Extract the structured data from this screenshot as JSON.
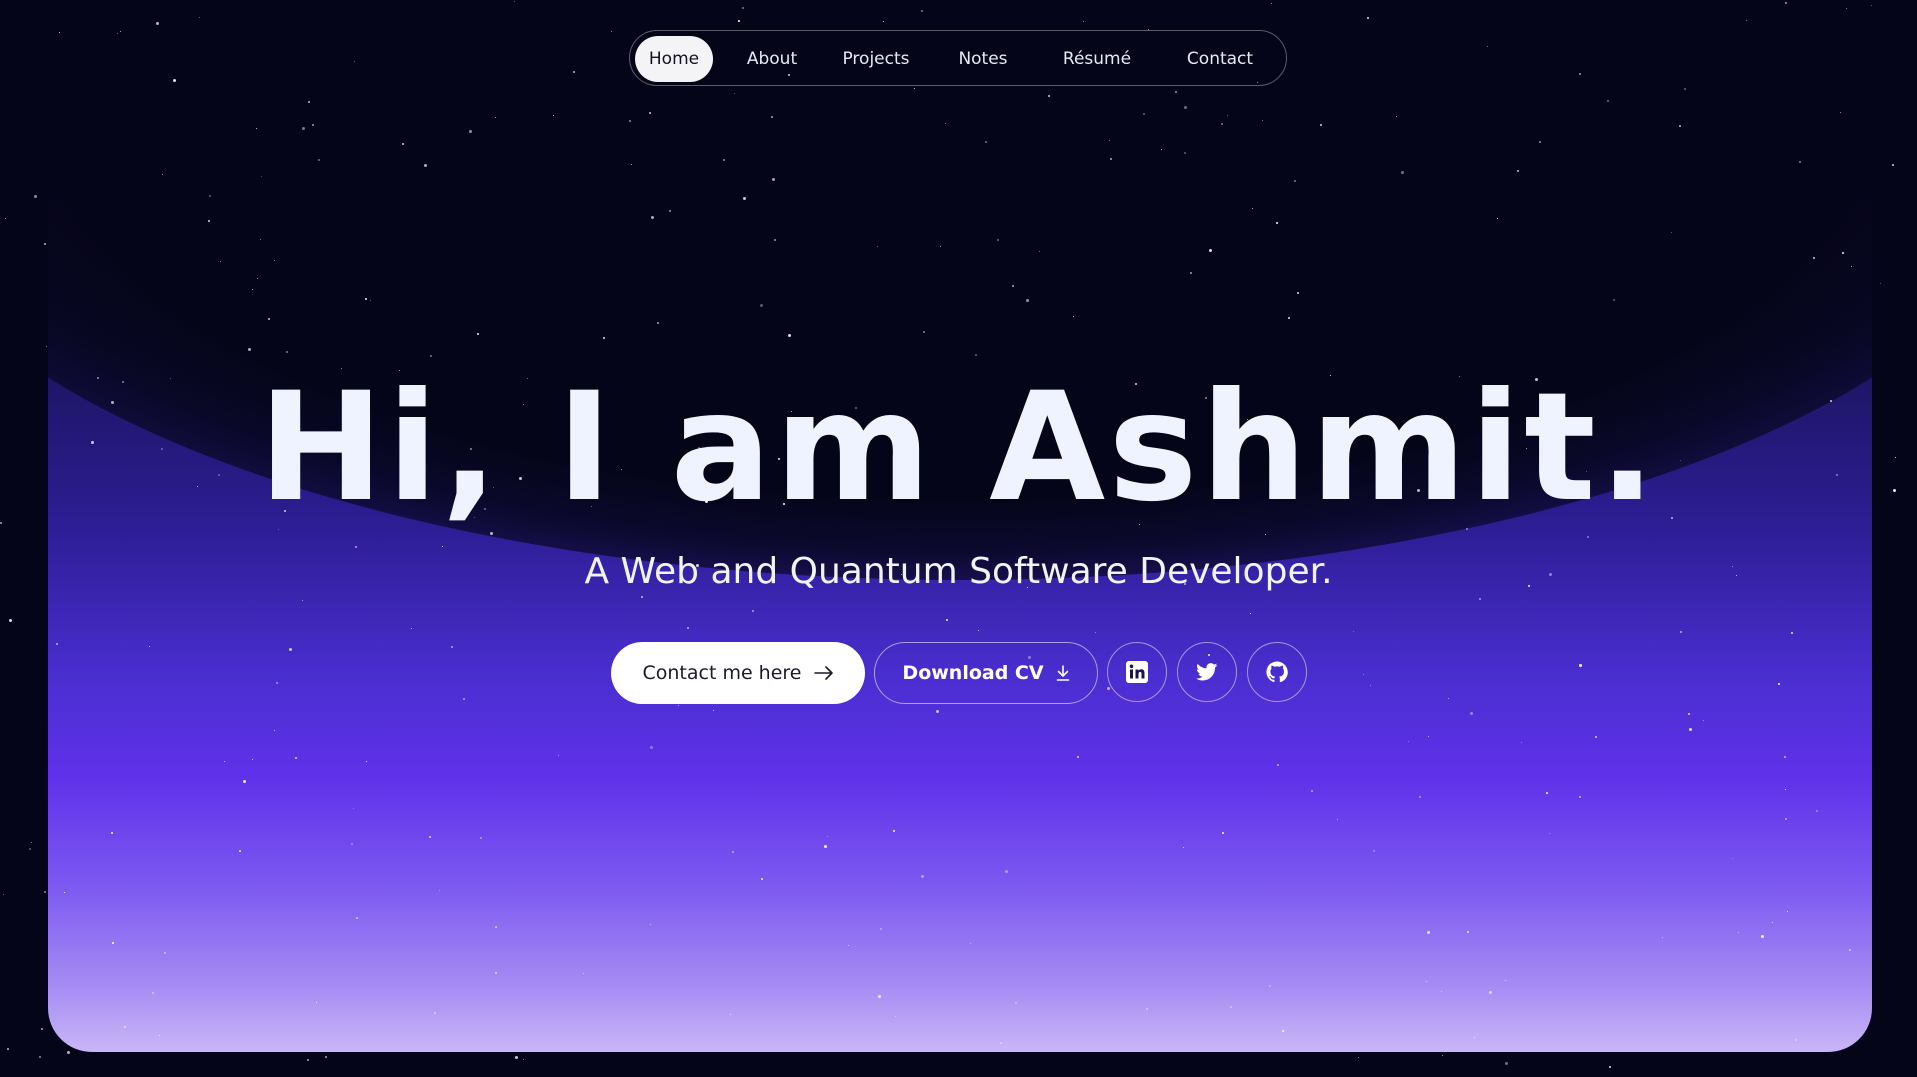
{
  "nav": {
    "items": [
      {
        "label": "Home",
        "active": true
      },
      {
        "label": "About",
        "active": false
      },
      {
        "label": "Projects",
        "active": false
      },
      {
        "label": "Notes",
        "active": false
      },
      {
        "label": "Résumé",
        "active": false
      },
      {
        "label": "Contact",
        "active": false
      }
    ]
  },
  "hero": {
    "title": "Hi, I am Ashmit.",
    "subtitle": "A Web and Quantum Software Developer."
  },
  "actions": {
    "contact_label": "Contact me here",
    "contact_icon": "arrow-right-icon",
    "cv_label": "Download CV",
    "cv_icon": "download-icon"
  },
  "social": [
    {
      "icon": "linkedin-icon"
    },
    {
      "icon": "twitter-icon"
    },
    {
      "icon": "github-icon"
    }
  ],
  "colors": {
    "background": "#05051a",
    "accent_violet": "#6032ea",
    "glow_bottom": "#c9b6f7",
    "title_text": "#eef3ff",
    "primary_button_bg": "#ffffff"
  }
}
